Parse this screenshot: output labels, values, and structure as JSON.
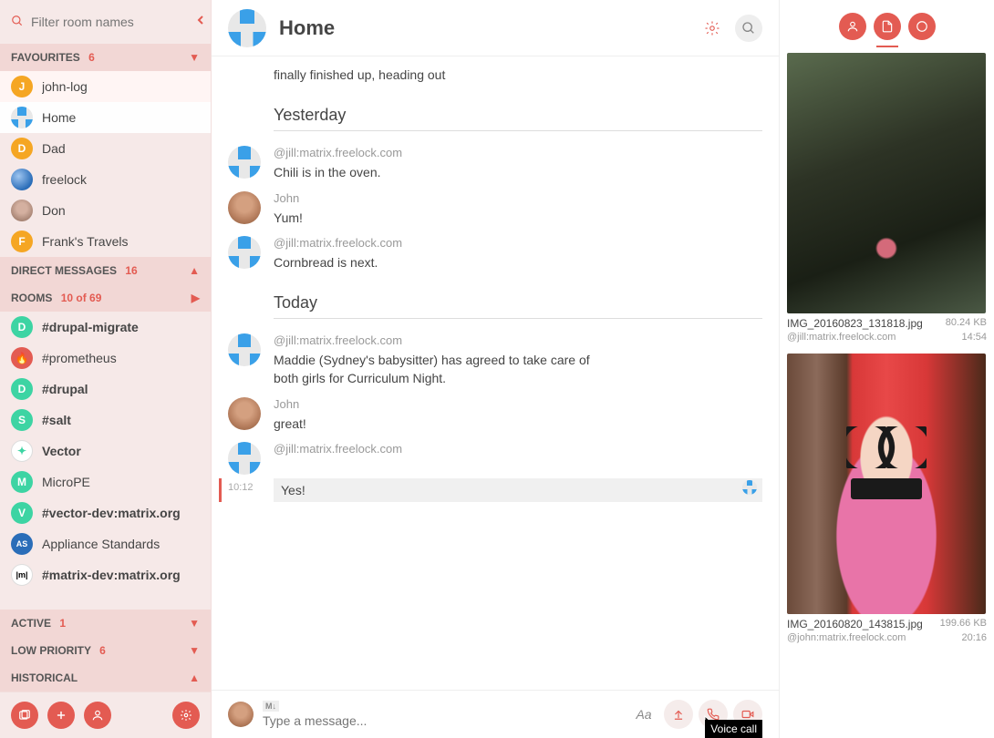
{
  "sidebar": {
    "filter_placeholder": "Filter room names",
    "sections": {
      "favourites": {
        "label": "FAVOURITES",
        "count": "6"
      },
      "direct": {
        "label": "DIRECT MESSAGES",
        "count": "16"
      },
      "rooms": {
        "label": "ROOMS",
        "count": "10 of 69"
      },
      "active": {
        "label": "ACTIVE",
        "count": "1"
      },
      "lowpriority": {
        "label": "LOW PRIORITY",
        "count": "6"
      },
      "historical": {
        "label": "HISTORICAL",
        "count": ""
      }
    },
    "favourites_items": [
      {
        "name": "john-log",
        "avatar_bg": "#f5a623",
        "initial": "J"
      },
      {
        "name": "Home",
        "avatar_type": "pixel"
      },
      {
        "name": "Dad",
        "avatar_bg": "#f5a623",
        "initial": "D"
      },
      {
        "name": "freelock",
        "avatar_type": "freelock"
      },
      {
        "name": "Don",
        "avatar_type": "photo-don"
      },
      {
        "name": "Frank's Travels",
        "avatar_bg": "#f5a623",
        "initial": "F"
      }
    ],
    "rooms_items": [
      {
        "name": "#drupal-migrate",
        "avatar_bg": "#3dd4a3",
        "initial": "D",
        "bold": true
      },
      {
        "name": "#prometheus",
        "avatar_bg": "#e35b52",
        "initial": "🔥"
      },
      {
        "name": "#drupal",
        "avatar_bg": "#3dd4a3",
        "initial": "D",
        "bold": true
      },
      {
        "name": "#salt",
        "avatar_bg": "#3dd4a3",
        "initial": "S",
        "bold": true
      },
      {
        "name": "Vector",
        "avatar_bg": "#fff",
        "initial": "V",
        "bold": true
      },
      {
        "name": "MicroPE",
        "avatar_bg": "#3dd4a3",
        "initial": "M"
      },
      {
        "name": "#vector-dev:matrix.org",
        "avatar_bg": "#3dd4a3",
        "initial": "V",
        "bold": true
      },
      {
        "name": "Appliance Standards",
        "avatar_type": "as"
      },
      {
        "name": "#matrix-dev:matrix.org",
        "avatar_type": "matrix",
        "bold": true
      }
    ]
  },
  "header": {
    "title": "Home"
  },
  "timeline": {
    "pre_msg": "finally finished up, heading out",
    "sep_yesterday": "Yesterday",
    "sep_today": "Today",
    "msgs": [
      {
        "sender": "@jill:matrix.freelock.com",
        "text": "Chili is in the oven.",
        "avatar": "pixel"
      },
      {
        "sender": "John",
        "text": "Yum!",
        "avatar": "john"
      },
      {
        "sender": "@jill:matrix.freelock.com",
        "text": "Cornbread is next.",
        "avatar": "pixel"
      }
    ],
    "today_msgs": [
      {
        "sender": "@jill:matrix.freelock.com",
        "text": "Maddie (Sydney's babysitter) has agreed to take care of both girls for Curriculum Night.",
        "avatar": "pixel"
      },
      {
        "sender": "John",
        "text": "great!",
        "avatar": "john"
      },
      {
        "sender": "@jill:matrix.freelock.com",
        "text": "Yes!",
        "avatar": "pixel",
        "highlighted": true,
        "ts": "10:12"
      }
    ]
  },
  "compose": {
    "md_label": "M↓",
    "placeholder": "Type a message...",
    "format_label": "Aa",
    "tooltip": "Voice call"
  },
  "rpanel": {
    "files": [
      {
        "name": "IMG_20160823_131818.jpg",
        "size": "80.24 KB",
        "sender": "@jill:matrix.freelock.com",
        "time": "14:54",
        "thumb": "tree"
      },
      {
        "name": "IMG_20160820_143815.jpg",
        "size": "199.66 KB",
        "sender": "@john:matrix.freelock.com",
        "time": "20:16",
        "thumb": "girl"
      }
    ]
  }
}
